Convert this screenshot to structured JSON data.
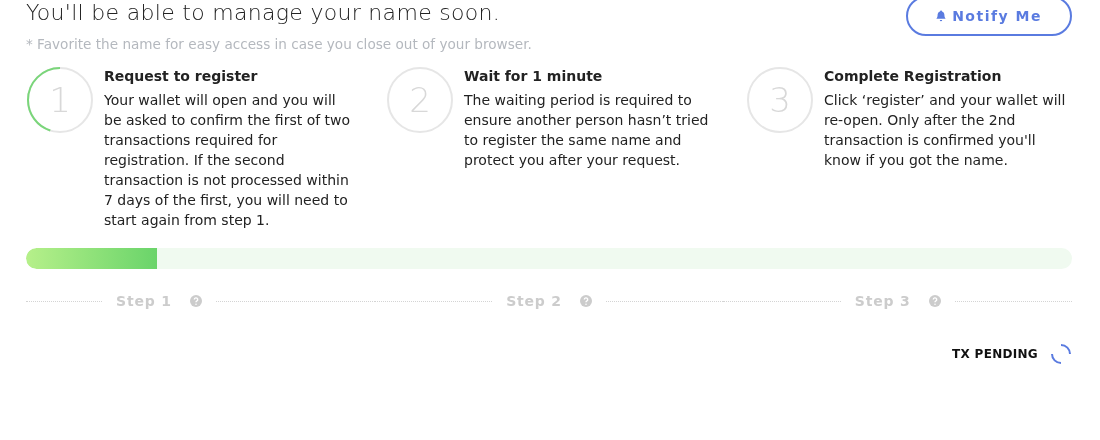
{
  "heading": "You'll be able to manage your name soon.",
  "note": "* Favorite the name for easy access in case you close out of your browser.",
  "notify_button": {
    "label": "Notify Me"
  },
  "steps": [
    {
      "number": "1",
      "title": "Request to register",
      "text": "Your wallet will open and you will be asked to confirm the first of two transactions required for registration. If the second transaction is not processed within 7 days of the first, you will need to start again from step 1.",
      "active": true
    },
    {
      "number": "2",
      "title": "Wait for 1 minute",
      "text": "The waiting period is required to ensure another person hasn’t tried to register the same name and protect you after your request.",
      "active": false
    },
    {
      "number": "3",
      "title": "Complete Registration",
      "text": "Click ‘register’ and your wallet will re-open. Only after the 2nd transaction is confirmed you'll know if you got the name.",
      "active": false
    }
  ],
  "progress": {
    "level": 0.125
  },
  "step_labels": [
    "Step 1",
    "Step 2",
    "Step 3"
  ],
  "status": "TX PENDING"
}
